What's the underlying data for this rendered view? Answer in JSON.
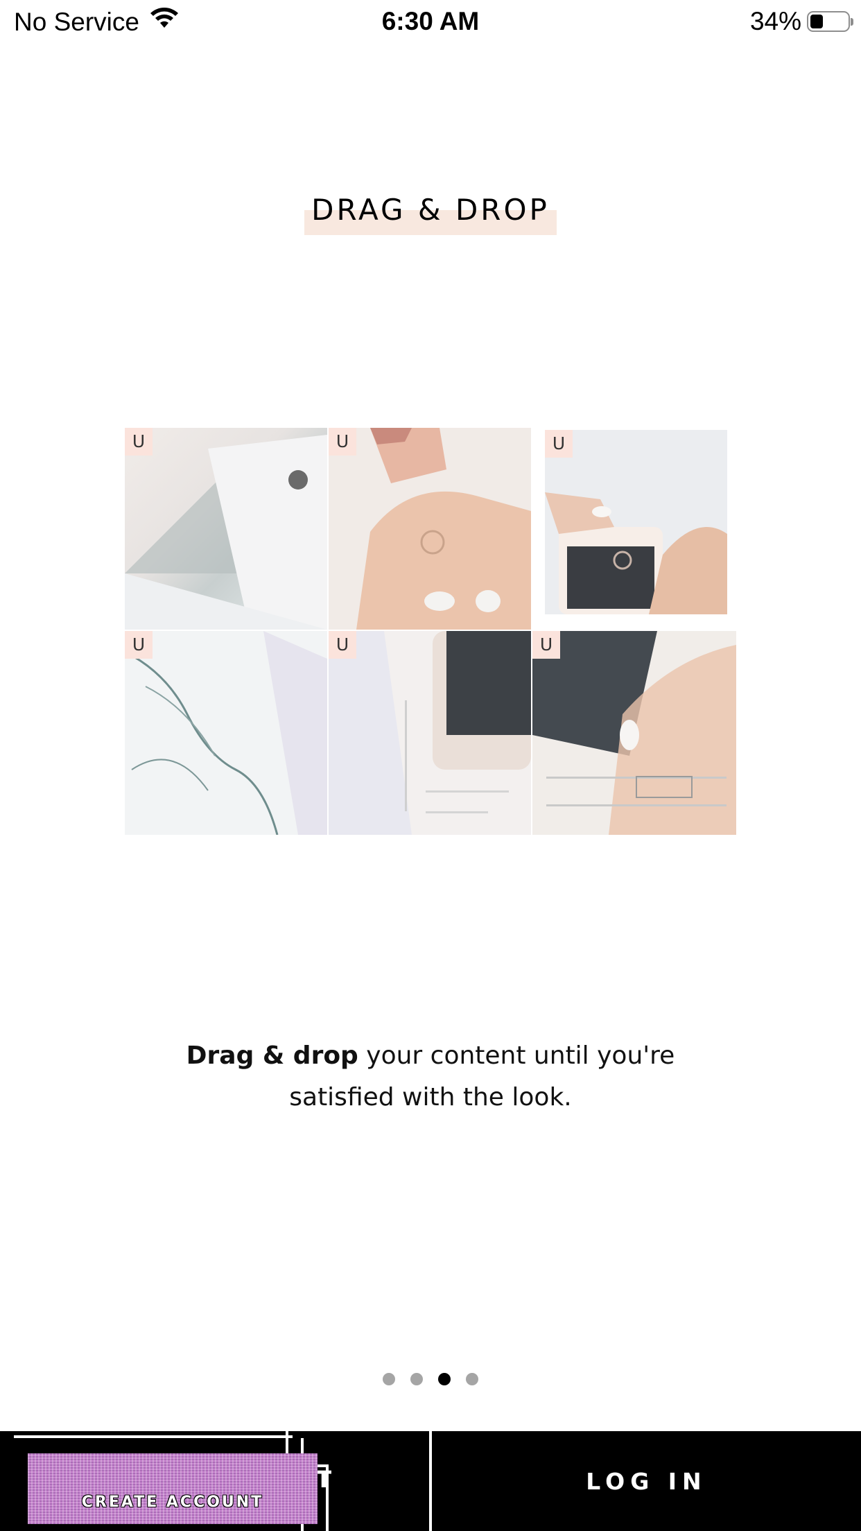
{
  "status_bar": {
    "carrier": "No Service",
    "time": "6:30 AM",
    "battery": "34%",
    "battery_level": 0.34
  },
  "title": "DRAG & DROP",
  "grid": {
    "badge": "U",
    "tiles": [
      "U",
      "U",
      "U",
      "U",
      "U",
      "U"
    ]
  },
  "description": {
    "bold": "Drag & drop",
    "rest_line1": " your content until you're",
    "line2": "satisfied with the look."
  },
  "pagination": {
    "total": 4,
    "active_index": 2
  },
  "buttons": {
    "create_account": "CREATE ACCOUNT",
    "create_account_partial": "NT",
    "log_in": "LOG IN"
  },
  "colors": {
    "title_highlight": "#f8e8df",
    "badge_bg": "#fbe3dc",
    "bottom_bar": "#000000",
    "dot_active": "#000000",
    "dot_inactive": "#a5a5a5"
  }
}
